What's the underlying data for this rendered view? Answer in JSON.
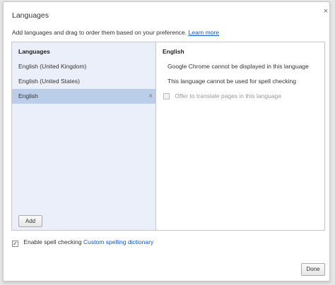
{
  "dialog": {
    "title": "Languages",
    "close_icon": "×",
    "description": "Add languages and drag to order them based on your preference.",
    "learn_more": "Learn more"
  },
  "languages": {
    "header": "Languages",
    "items": [
      {
        "label": "English (United Kingdom)",
        "selected": false
      },
      {
        "label": "English (United States)",
        "selected": false
      },
      {
        "label": "English",
        "selected": true
      }
    ],
    "remove_icon": "×",
    "add_label": "Add"
  },
  "details": {
    "title": "English",
    "line1": "Google Chrome cannot be displayed in this language",
    "line2": "This language cannot be used for spell checking",
    "offer_translate": "Offer to translate pages in this language",
    "offer_checked": false
  },
  "footer": {
    "spell_check_label": "Enable spell checking",
    "spell_check_checked": true,
    "custom_dictionary": "Custom spelling dictionary",
    "done_label": "Done"
  },
  "colors": {
    "list_bg": "#ebeff9",
    "selected_bg": "#bbcee9",
    "link": "#1155cc"
  }
}
